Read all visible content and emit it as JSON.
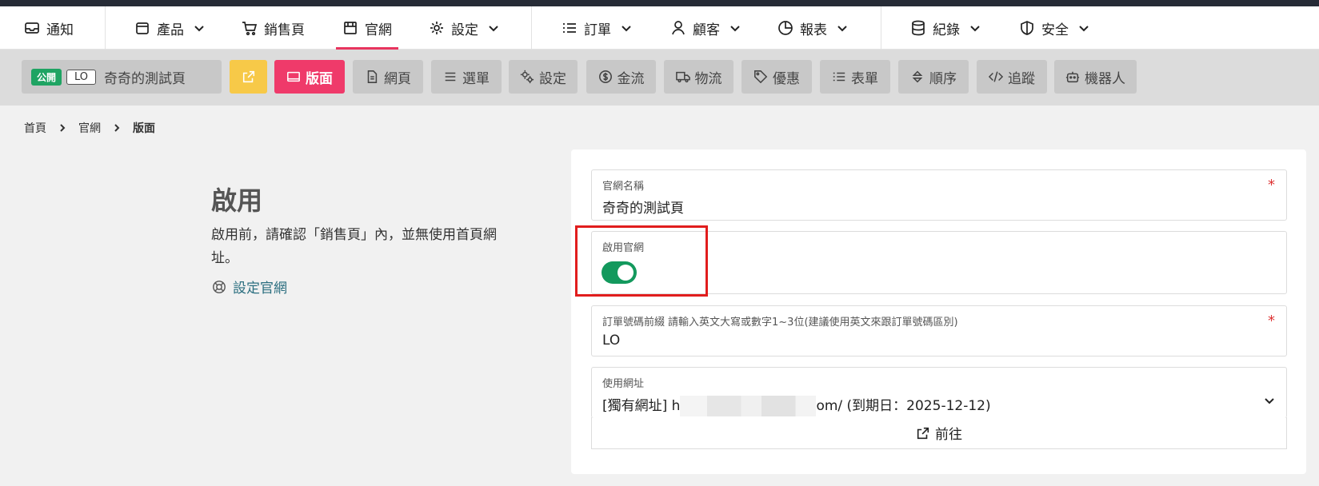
{
  "nav": {
    "notify": "通知",
    "products": "產品",
    "sales_page": "銷售頁",
    "website": "官網",
    "settings": "設定",
    "orders": "訂單",
    "customers": "顧客",
    "reports": "報表",
    "records": "紀錄",
    "security": "安全"
  },
  "toolbar": {
    "status_badge": "公開",
    "site_code": "LO",
    "site_name": "奇奇的測試頁",
    "layout": "版面",
    "pages": "網頁",
    "menu": "選單",
    "settings": "設定",
    "payment": "金流",
    "logistics": "物流",
    "discount": "優惠",
    "forms": "表單",
    "order": "順序",
    "tracking": "追蹤",
    "bot": "機器人"
  },
  "breadcrumb": {
    "home": "首頁",
    "website": "官網",
    "current": "版面"
  },
  "section": {
    "title": "啟用",
    "description": "啟用前，請確認「銷售頁」內，並無使用首頁網址。",
    "link": "設定官網"
  },
  "form": {
    "site_name_label": "官網名稱",
    "site_name_value": "奇奇的測試頁",
    "enable_label": "啟用官網",
    "enable_on": true,
    "prefix_label": "訂單號碼前綴",
    "prefix_hint": "請輸入英文大寫或數字1~3位(建議使用英文來跟訂單號碼區別)",
    "prefix_value": "LO",
    "url_label": "使用網址",
    "url_prefix": "[獨有網址] h",
    "url_suffix": "om/ (到期日：2025-12-12)",
    "go_button": "前往",
    "required_mark": "*"
  }
}
